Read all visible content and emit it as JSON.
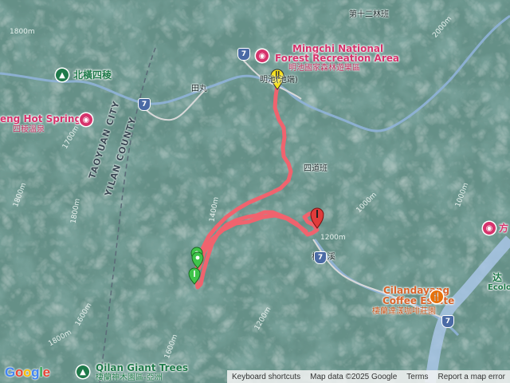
{
  "map": {
    "places": [
      {
        "id": "lin-12",
        "text": "第十二林班"
      },
      {
        "id": "tianwan",
        "text": "田丸"
      },
      {
        "id": "sidao",
        "text": "四道班"
      },
      {
        "id": "linsen",
        "text": "林森溪"
      }
    ],
    "pois": {
      "mingchi_en_1": "Mingchi National",
      "mingchi_en_2": "Forest Recreation Area",
      "mingchi_zh": "明池國家森林遊樂區",
      "mingchi_zh_short": "明池(池端)",
      "beiheng": "北橫四稜",
      "hotsprings_en": "eng Hot Springs",
      "hotsprings_zh": "四稜溫泉",
      "cilan_en_1": "Cilandayang",
      "cilan_en_2": "Coffee Estate",
      "cilan_zh": "棲蘭達漾咖啡莊園",
      "giant_en": "Qilan Giant Trees",
      "giant_zh": "棲蘭神木園區-亞洲",
      "edge_right_1": "达",
      "edge_right_2": "Ecolo",
      "edge_right_3": "方"
    },
    "county_line": {
      "left": "TAOYUAN CITY",
      "right": "YILAN COUNTY"
    },
    "route_shields": [
      "7",
      "7",
      "7",
      "7"
    ],
    "contours": [
      "1800m",
      "1700m",
      "1800m",
      "1800m",
      "1400m",
      "1200m",
      "1000m",
      "1600m",
      "2000m",
      "1800m",
      "1600m",
      "1200m",
      "1000m"
    ],
    "track_color": "#f0636e",
    "start_marker_color": "#f5e11c",
    "end_marker_color": "#e03b3b",
    "waypoint_color": "#3fc44a",
    "logo": "Google",
    "attribution": {
      "shortcuts": "Keyboard shortcuts",
      "data": "Map data ©2025 Google",
      "terms": "Terms",
      "report": "Report a map error"
    }
  }
}
